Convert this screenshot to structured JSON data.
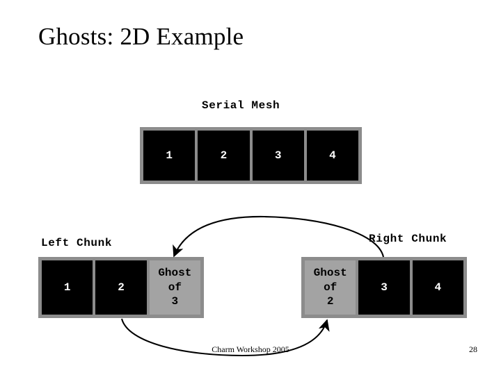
{
  "slide": {
    "title": "Ghosts: 2D Example",
    "footer": "Charm Workshop 2005",
    "page_number": "28"
  },
  "colors": {
    "owned_cell_bg": "#000000",
    "owned_cell_text": "#ffffff",
    "ghost_cell_bg": "#a3a3a3",
    "ghost_cell_text": "#000000",
    "mesh_border": "#8c8c8c",
    "background": "#ffffff",
    "arrow": "#000000"
  },
  "serial_mesh": {
    "label": "Serial Mesh",
    "cells": [
      {
        "text": "1",
        "kind": "owned"
      },
      {
        "text": "2",
        "kind": "owned"
      },
      {
        "text": "3",
        "kind": "owned"
      },
      {
        "text": "4",
        "kind": "owned"
      }
    ]
  },
  "left_chunk": {
    "label": "Left Chunk",
    "cells": [
      {
        "text": "1",
        "kind": "owned"
      },
      {
        "text": "2",
        "kind": "owned"
      },
      {
        "text": "Ghost\nof\n3",
        "kind": "ghost"
      }
    ]
  },
  "right_chunk": {
    "label": "Right Chunk",
    "cells": [
      {
        "text": "Ghost\nof\n2",
        "kind": "ghost"
      },
      {
        "text": "3",
        "kind": "owned"
      },
      {
        "text": "4",
        "kind": "owned"
      }
    ]
  },
  "arrows": [
    {
      "name": "arrow-right-3-to-left-ghost-of-3",
      "from": "right chunk cell 3",
      "to": "left chunk Ghost of 3"
    },
    {
      "name": "arrow-left-2-to-right-ghost-of-2",
      "from": "left chunk cell 2",
      "to": "right chunk Ghost of 2"
    }
  ]
}
